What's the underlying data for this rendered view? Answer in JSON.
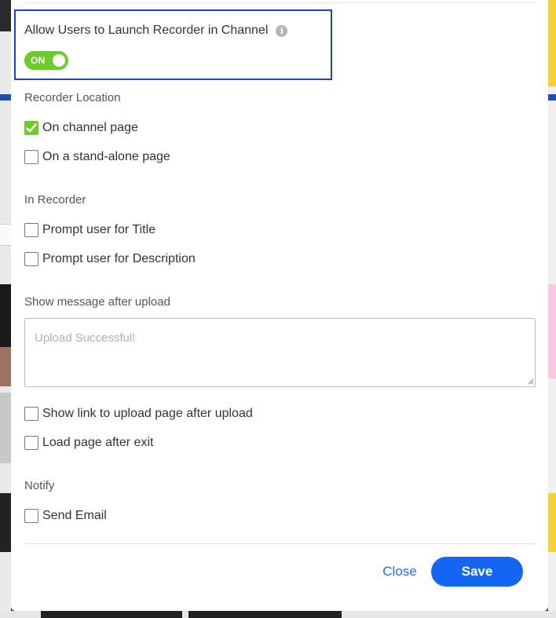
{
  "dialog": {
    "title": "Allow Users to Launch Recorder in Channel",
    "info_icon": "info-icon",
    "toggle": {
      "label": "ON",
      "state": "on",
      "color": "#6ccc2c"
    }
  },
  "recorder_location": {
    "label": "Recorder Location",
    "options": [
      {
        "label": "On channel page",
        "checked": true
      },
      {
        "label": "On a stand-alone page",
        "checked": false
      }
    ]
  },
  "in_recorder": {
    "label": "In Recorder",
    "options": [
      {
        "label": "Prompt user for Title",
        "checked": false
      },
      {
        "label": "Prompt user for Description",
        "checked": false
      }
    ]
  },
  "upload_message": {
    "label": "Show message after upload",
    "placeholder": "Upload Successful!",
    "value": ""
  },
  "after_upload": {
    "options": [
      {
        "label": "Show link to upload page after upload",
        "checked": false
      },
      {
        "label": "Load page after exit",
        "checked": false
      }
    ]
  },
  "notify": {
    "label": "Notify",
    "options": [
      {
        "label": "Send Email",
        "checked": false
      }
    ]
  },
  "footer": {
    "close_label": "Close",
    "save_label": "Save"
  },
  "colors": {
    "accent_green": "#6ccc2c",
    "primary_blue": "#1565f5",
    "highlight_border": "#1f3fe0"
  }
}
